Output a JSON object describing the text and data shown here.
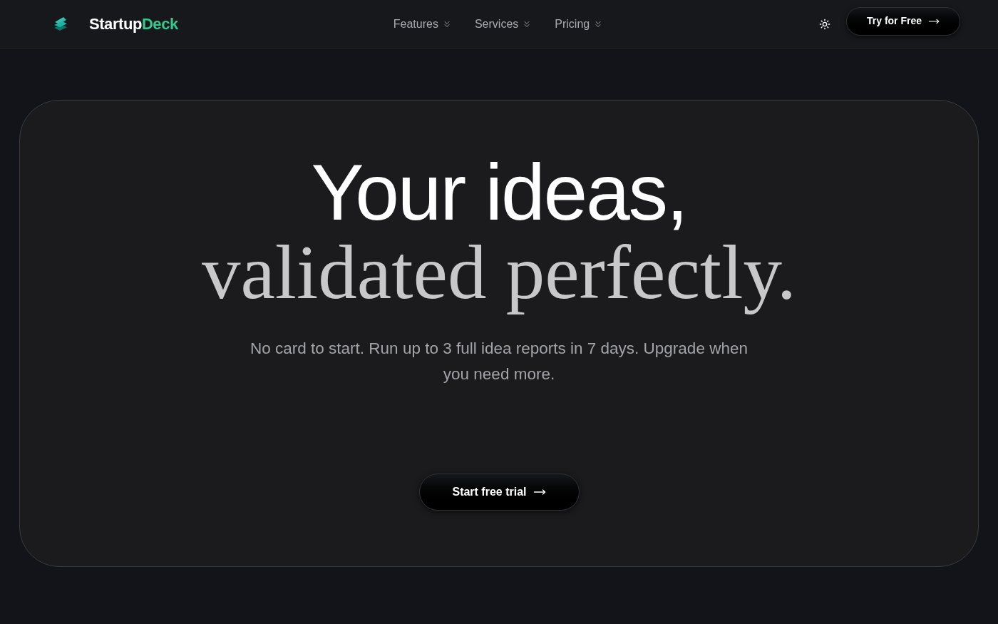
{
  "header": {
    "brand": {
      "first": "Startup",
      "second": "Deck"
    },
    "nav": [
      {
        "label": "Features"
      },
      {
        "label": "Services"
      },
      {
        "label": "Pricing"
      }
    ],
    "cta": {
      "label": "Try for Free"
    }
  },
  "hero": {
    "headline_line_1": "Your ideas,",
    "headline_line_2": "validated perfectly.",
    "subtitle": "No card to start. Run up to 3 full idea reports in 7 days. Upgrade when you need more.",
    "cta": {
      "label": "Start free trial"
    }
  }
}
